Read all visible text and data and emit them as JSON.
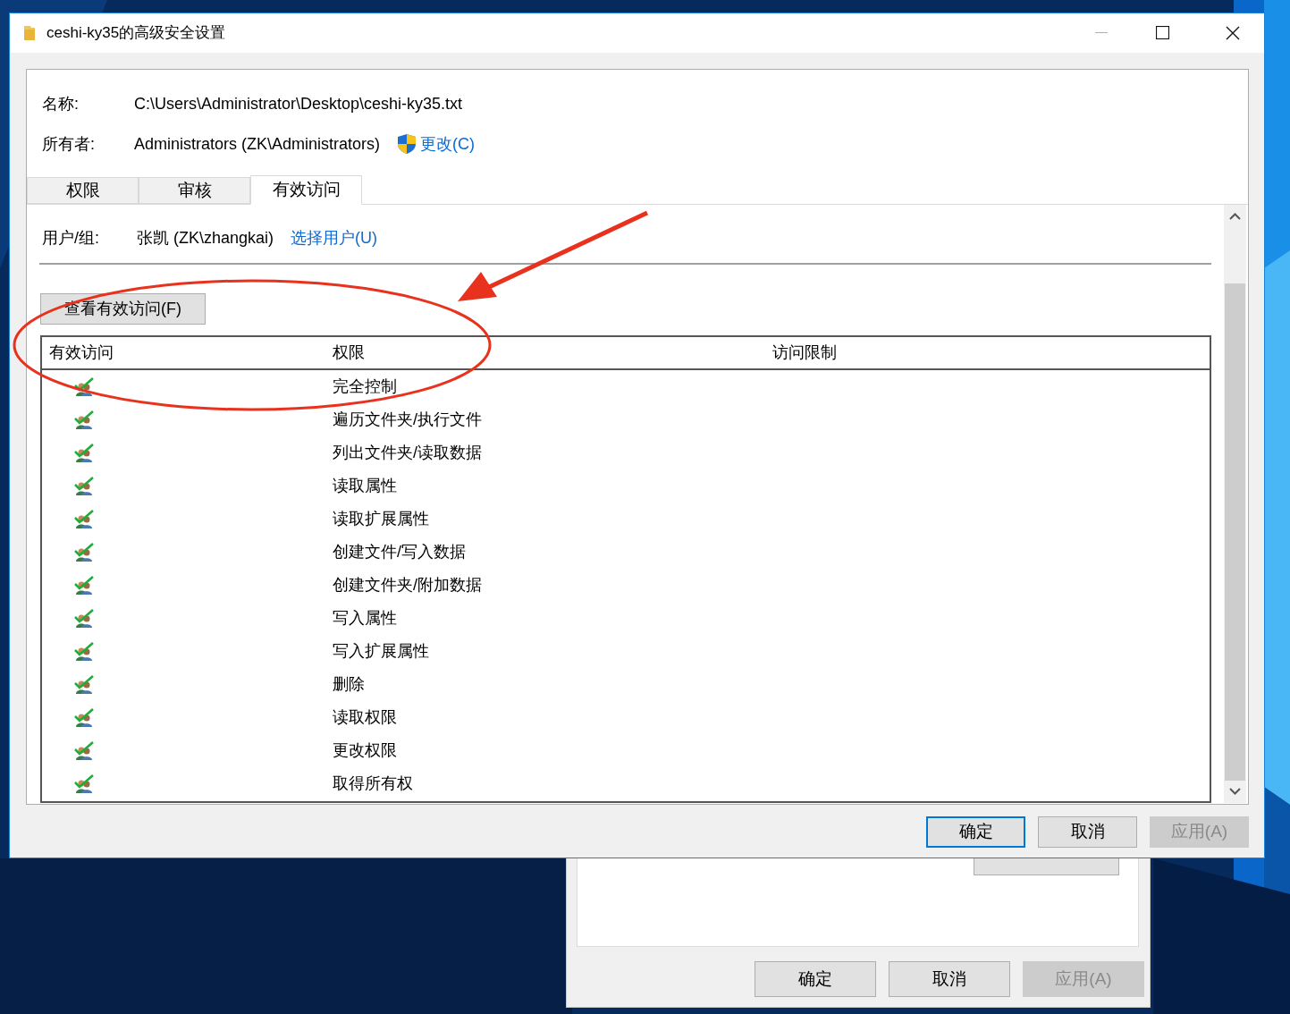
{
  "window": {
    "title": "ceshi-ky35的高级安全设置"
  },
  "name": {
    "label": "名称:",
    "value": "C:\\Users\\Administrator\\Desktop\\ceshi-ky35.txt"
  },
  "owner": {
    "label": "所有者:",
    "value": "Administrators (ZK\\Administrators)",
    "link": "更改(C)"
  },
  "tabs": [
    {
      "label": "权限",
      "selected": false
    },
    {
      "label": "审核",
      "selected": false
    },
    {
      "label": "有效访问",
      "selected": true
    }
  ],
  "user_group": {
    "label": "用户/组:",
    "value": "张凯 (ZK\\zhangkai)",
    "link": "选择用户(U)"
  },
  "view_button": "查看有效访问(F)",
  "table": {
    "columns": [
      "有效访问",
      "权限",
      "访问限制"
    ],
    "rows": [
      {
        "allowed": true,
        "permission": "完全控制"
      },
      {
        "allowed": true,
        "permission": "遍历文件夹/执行文件"
      },
      {
        "allowed": true,
        "permission": "列出文件夹/读取数据"
      },
      {
        "allowed": true,
        "permission": "读取属性"
      },
      {
        "allowed": true,
        "permission": "读取扩展属性"
      },
      {
        "allowed": true,
        "permission": "创建文件/写入数据"
      },
      {
        "allowed": true,
        "permission": "创建文件夹/附加数据"
      },
      {
        "allowed": true,
        "permission": "写入属性"
      },
      {
        "allowed": true,
        "permission": "写入扩展属性"
      },
      {
        "allowed": true,
        "permission": "删除"
      },
      {
        "allowed": true,
        "permission": "读取权限"
      },
      {
        "allowed": true,
        "permission": "更改权限"
      },
      {
        "allowed": true,
        "permission": "取得所有权"
      }
    ]
  },
  "buttons": [
    {
      "label": "确定",
      "default": true,
      "disabled": false
    },
    {
      "label": "取消",
      "default": false,
      "disabled": false
    },
    {
      "label": "应用(A)",
      "default": false,
      "disabled": true
    }
  ],
  "background_window": {
    "buttons": [
      {
        "label": "确定",
        "disabled": false
      },
      {
        "label": "取消",
        "disabled": false
      },
      {
        "label": "应用(A)",
        "disabled": true
      }
    ]
  }
}
